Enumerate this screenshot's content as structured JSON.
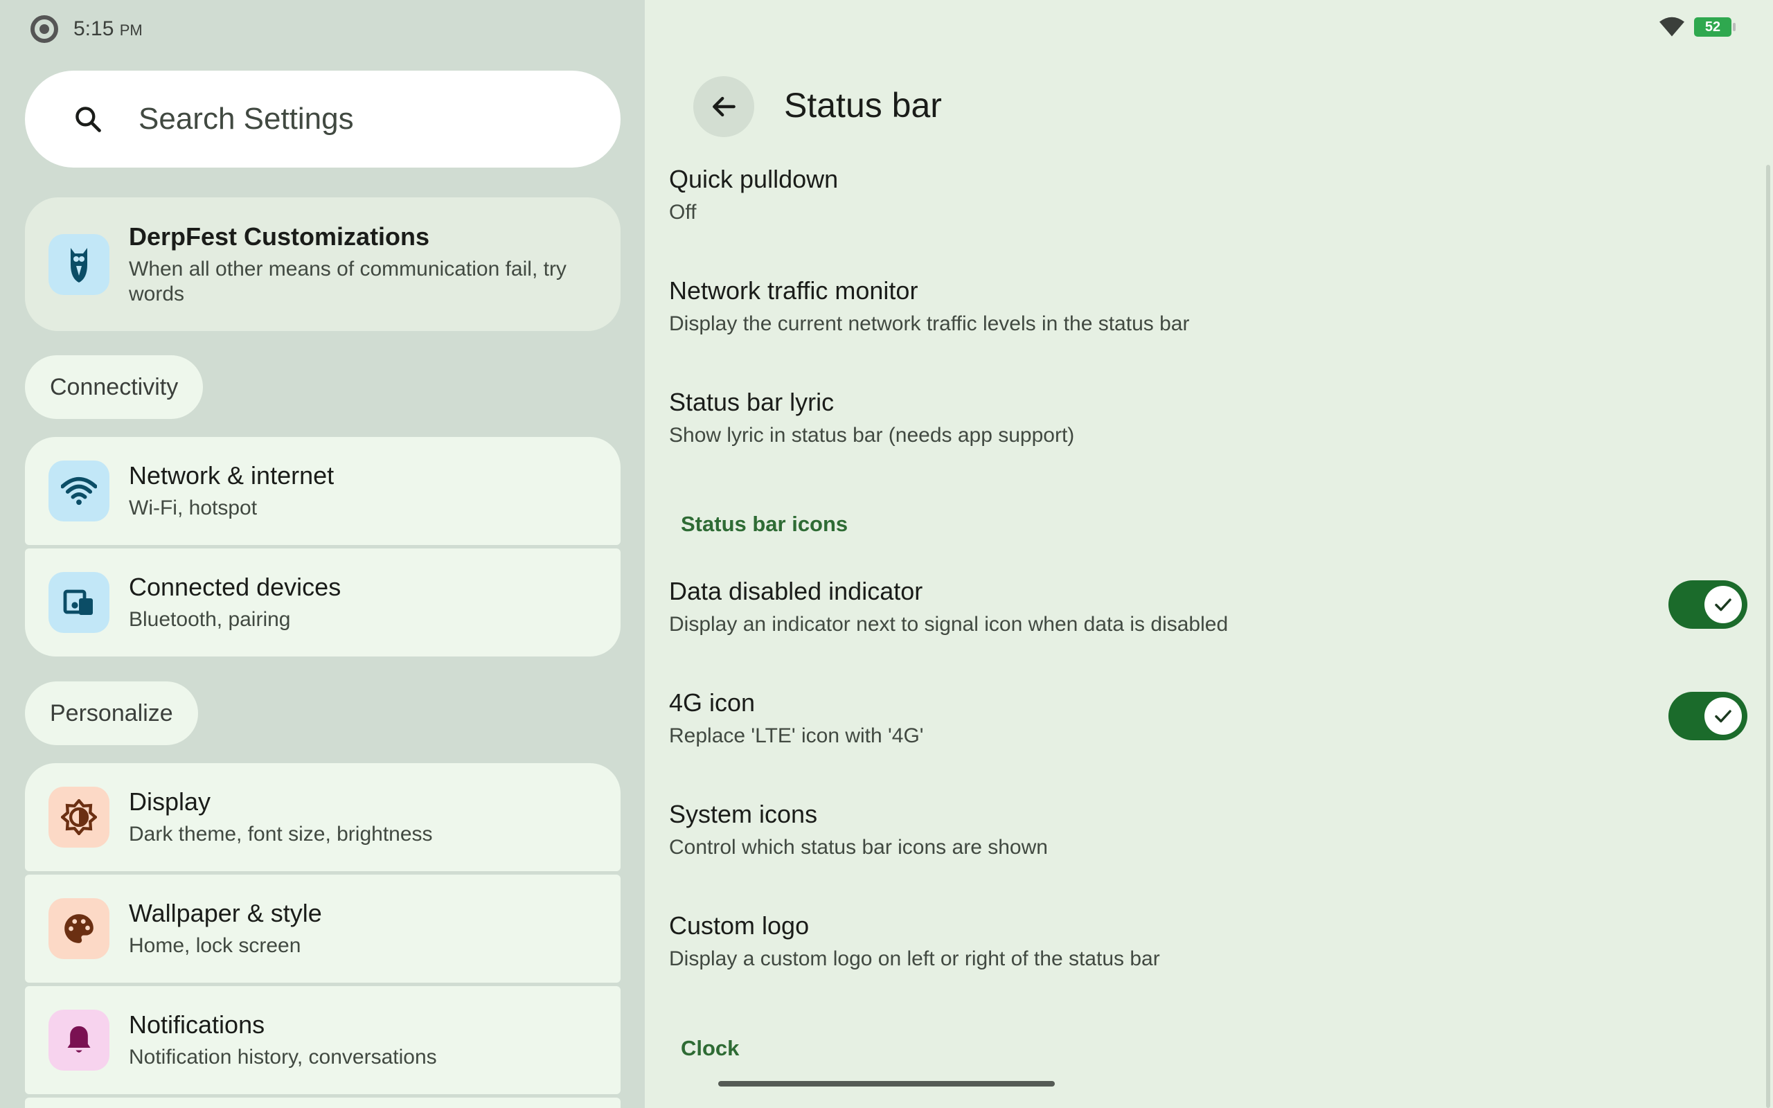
{
  "status": {
    "time": "5:15",
    "ampm": "PM",
    "battery": "52"
  },
  "search": {
    "placeholder": "Search Settings"
  },
  "derpfest": {
    "title": "DerpFest Customizations",
    "subtitle": "When all other means of communication fail, try words"
  },
  "sections": {
    "connectivity": "Connectivity",
    "personalize": "Personalize"
  },
  "settings": [
    {
      "title": "Network & internet",
      "subtitle": "Wi-Fi, hotspot",
      "icon": "wifi-icon",
      "icon_bg": "#c2e7f7",
      "icon_color": "#0b4d66"
    },
    {
      "title": "Connected devices",
      "subtitle": "Bluetooth, pairing",
      "icon": "devices-icon",
      "icon_bg": "#c2e7f7",
      "icon_color": "#0b4d66"
    },
    {
      "title": "Display",
      "subtitle": "Dark theme, font size, brightness",
      "icon": "brightness-icon",
      "icon_bg": "#fcd9c6",
      "icon_color": "#6b2f12"
    },
    {
      "title": "Wallpaper & style",
      "subtitle": "Home, lock screen",
      "icon": "palette-icon",
      "icon_bg": "#fcd9c6",
      "icon_color": "#6b2f12"
    },
    {
      "title": "Notifications",
      "subtitle": "Notification history, conversations",
      "icon": "bell-icon",
      "icon_bg": "#f7d3ee",
      "icon_color": "#7a1152"
    }
  ],
  "page": {
    "title": "Status bar",
    "prefs": [
      {
        "title": "Quick pulldown",
        "subtitle": "Off"
      },
      {
        "title": "Network traffic monitor",
        "subtitle": "Display the current network traffic levels in the status bar"
      },
      {
        "title": "Status bar lyric",
        "subtitle": "Show lyric in status bar (needs app support)"
      },
      {
        "title": "Data disabled indicator",
        "subtitle": "Display an indicator next to signal icon when data is disabled",
        "toggle": true
      },
      {
        "title": "4G icon",
        "subtitle": "Replace 'LTE' icon with '4G'",
        "toggle": true
      },
      {
        "title": "System icons",
        "subtitle": "Control which status bar icons are shown"
      },
      {
        "title": "Custom logo",
        "subtitle": "Display a custom logo on left or right of the status bar"
      }
    ],
    "categories": {
      "icons": "Status bar icons",
      "clock": "Clock"
    }
  },
  "colors": {
    "accent": "#1b6b2b",
    "category": "#2e6b34"
  }
}
